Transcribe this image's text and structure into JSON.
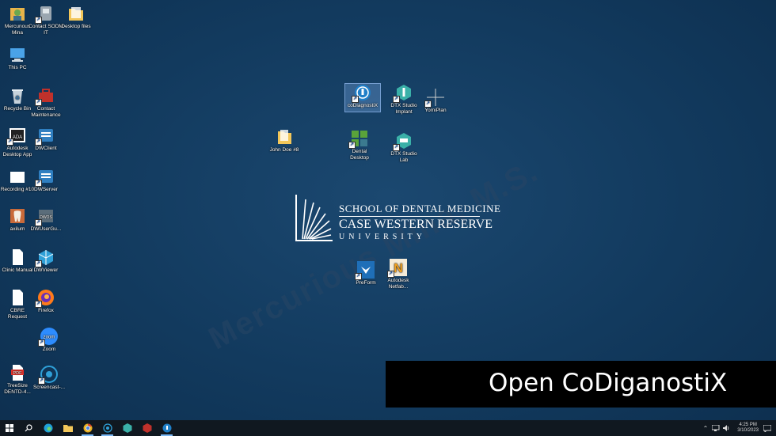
{
  "desktop_icons_left": [
    {
      "label": "Mercunous Mina",
      "icon": "user-folder-icon",
      "color": "#e8b44a"
    },
    {
      "label": "Contact SODM IT",
      "icon": "phone-icon",
      "color": "#9aa6b0"
    },
    {
      "label": "Desktop files",
      "icon": "folder-icon",
      "color": "#f3c75a"
    },
    {
      "label": "This PC",
      "icon": "computer-icon",
      "color": "#4aa3e8"
    },
    {
      "label": "Recycle Bin",
      "icon": "recycle-bin-icon",
      "color": "#c7d3dc"
    },
    {
      "label": "Contact Maintenance",
      "icon": "toolbox-icon",
      "color": "#c0312b"
    },
    {
      "label": "Autodesk Desktop App",
      "icon": "autodesk-icon",
      "color": "#222222"
    },
    {
      "label": "DWClient",
      "icon": "dw-client-icon",
      "color": "#2f7fc1"
    },
    {
      "label": "Recording #10",
      "icon": "document-icon",
      "color": "#ffffff"
    },
    {
      "label": "DWServer",
      "icon": "dw-server-icon",
      "color": "#2f7fc1"
    },
    {
      "label": "axilum",
      "icon": "tooth-icon",
      "color": "#e8e3d8"
    },
    {
      "label": "DWUserGu...",
      "icon": "dw-guide-icon",
      "color": "#5b6d7a"
    },
    {
      "label": "Clinic Manual",
      "icon": "document-icon",
      "color": "#ffffff"
    },
    {
      "label": "DWViewer",
      "icon": "dw-viewer-icon",
      "color": "#2fa0d8"
    },
    {
      "label": "CBRE Request",
      "icon": "document-icon",
      "color": "#ffffff"
    },
    {
      "label": "Firefox",
      "icon": "firefox-icon",
      "color": "#ff7a1a"
    },
    {
      "label": "Zoom",
      "icon": "zoom-icon",
      "color": "#2d8cff"
    },
    {
      "label": "TreeSize DENTD-4...",
      "icon": "pdf-icon",
      "color": "#e0322b"
    },
    {
      "label": "Screencast-...",
      "icon": "screencast-icon",
      "color": "#2fa0d8"
    }
  ],
  "desktop_icons_center": [
    {
      "label": "coDiagnostiX",
      "icon": "codiagnostix-icon",
      "color": "#1f7fc8"
    },
    {
      "label": "DTX Studio Implant",
      "icon": "dtx-implant-icon",
      "color": "#3ab0a8"
    },
    {
      "label": "YomiPlan",
      "icon": "crosshair-icon",
      "color": "#cfcfcf"
    },
    {
      "label": "John Doe #8",
      "icon": "folder-icon",
      "color": "#f3c75a"
    },
    {
      "label": "Dental Desktop",
      "icon": "dental-desktop-icon",
      "color": "#5aa33a"
    },
    {
      "label": "DTX Studio Lab",
      "icon": "dtx-lab-icon",
      "color": "#3ab0a8"
    },
    {
      "label": "PreForm",
      "icon": "preform-icon",
      "color": "#1f6fb8"
    },
    {
      "label": "Autodesk Netfab...",
      "icon": "netfabb-icon",
      "color": "#f0a020"
    }
  ],
  "logo": {
    "line1": "SCHOOL OF DENTAL MEDICINE",
    "line2": "CASE WESTERN RESERVE",
    "line3": "UNIVERSITY"
  },
  "watermark": "Mercurious Mina, M.S.",
  "caption": "Open CoDiganostiX",
  "taskbar": {
    "time": "4:25 PM",
    "date": "3/10/2023",
    "apps": [
      {
        "name": "edge-icon",
        "color": "#1fa0d8"
      },
      {
        "name": "file-explorer-icon",
        "color": "#f3c75a"
      },
      {
        "name": "chrome-icon",
        "color": "#e8b020"
      },
      {
        "name": "screencast-icon",
        "color": "#2fa0d8"
      },
      {
        "name": "dtx-studio-icon",
        "color": "#3ab0a8"
      },
      {
        "name": "dental-app-icon",
        "color": "#c0312b"
      },
      {
        "name": "codiagnostix-icon",
        "color": "#1f7fc8"
      }
    ]
  }
}
